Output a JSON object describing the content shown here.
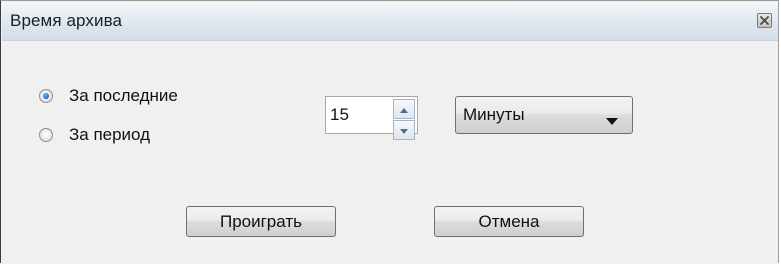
{
  "window": {
    "title": "Время архива",
    "close_icon": "close-icon"
  },
  "mode": {
    "options": [
      {
        "label": "За последние",
        "checked": true
      },
      {
        "label": "За период",
        "checked": false
      }
    ]
  },
  "amount": {
    "value": "15"
  },
  "unit": {
    "selected": "Минуты"
  },
  "buttons": {
    "play_label": "Проиграть",
    "cancel_label": "Отмена"
  },
  "colors": {
    "radio_selected": "#1f6fd1",
    "titlebar": "#dfe7f0",
    "dialog_bg": "#f0f0f0"
  }
}
